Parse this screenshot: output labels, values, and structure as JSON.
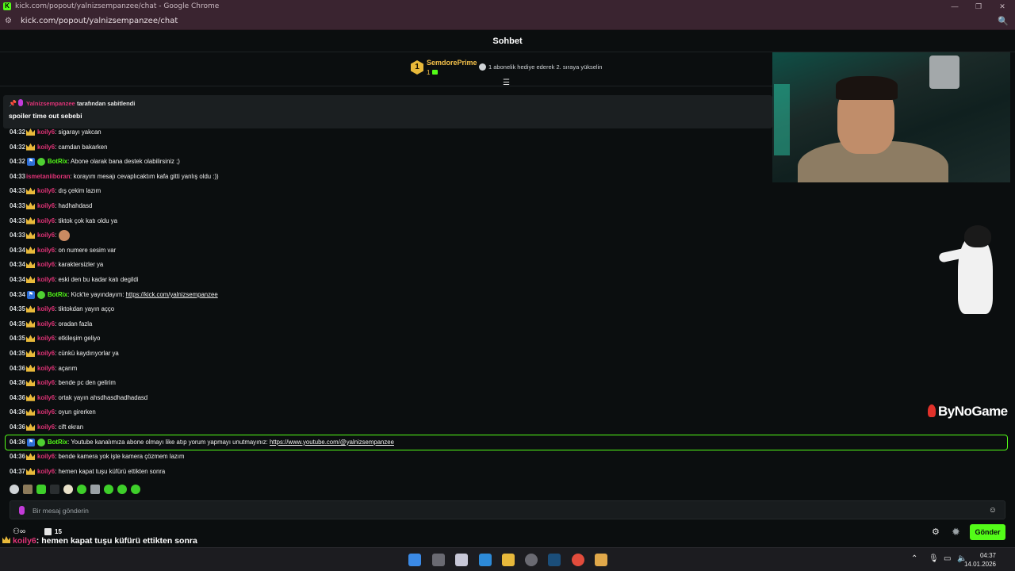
{
  "browser": {
    "window_title": "kick.com/popout/yalnizsempanzee/chat - Google Chrome",
    "favicon_letter": "K",
    "url": "kick.com/popout/yalnizsempanzee/chat"
  },
  "chat_header": {
    "title": "Sohbet"
  },
  "leaderboard": {
    "rank": "1",
    "name": "SemdorePrime",
    "gift_count": "1",
    "hint": "1 abonelik hediye ederek 2. sıraya yükselin"
  },
  "pinned": {
    "pinned_user": "Yalnizsempanzee",
    "pinned_by": "tarafından sabitlendi",
    "message": "spoiler time out sebebi"
  },
  "messages": [
    {
      "time": "04:32",
      "user": "koily6",
      "text": ": sigarayı yakcan"
    },
    {
      "time": "04:32",
      "user": "koily6",
      "text": ": camdan bakarken"
    },
    {
      "time": "04:32",
      "user": "BotRix",
      "text": ": Abone olarak bana destek olabilirsiniz ;)"
    },
    {
      "time": "04:33",
      "user": "ismetaniiboran",
      "text": ": korayım mesajı cevaplıcaktım kafa gitti yanlış oldu :))"
    },
    {
      "time": "04:33",
      "user": "koily6",
      "text": ": dış çekim lazım"
    },
    {
      "time": "04:33",
      "user": "koily6",
      "text": ": hadhahdasd"
    },
    {
      "time": "04:33",
      "user": "koily6",
      "text": ": tiktok çok katı oldu ya"
    },
    {
      "time": "04:33",
      "user": "koily6",
      "text": ":"
    },
    {
      "time": "04:34",
      "user": "koily6",
      "text": ": on numere sesim var"
    },
    {
      "time": "04:34",
      "user": "koily6",
      "text": ": karaktersizler ya"
    },
    {
      "time": "04:34",
      "user": "koily6",
      "text": ": eski den bu kadar katı degildi"
    },
    {
      "time": "04:34",
      "user": "BotRix",
      "text": ": Kick'te yayındayım: ",
      "link": "https://kick.com/yalnizsempanzee"
    },
    {
      "time": "04:35",
      "user": "koily6",
      "text": ": tiktokdan yayın açço"
    },
    {
      "time": "04:35",
      "user": "koily6",
      "text": ": oradan fazla"
    },
    {
      "time": "04:35",
      "user": "koily6",
      "text": ": etkileşim geliyo"
    },
    {
      "time": "04:35",
      "user": "koily6",
      "text": ": cünkü kaydırıyorlar ya"
    },
    {
      "time": "04:36",
      "user": "koily6",
      "text": ": açarım"
    },
    {
      "time": "04:36",
      "user": "koily6",
      "text": ": bende pc den gelirim"
    },
    {
      "time": "04:36",
      "user": "koily6",
      "text": ": ortak yayın ahsdhasdhadhadasd"
    },
    {
      "time": "04:36",
      "user": "koily6",
      "text": ": oyun girerken"
    },
    {
      "time": "04:36",
      "user": "koily6",
      "text": ": cift ekran"
    },
    {
      "time": "04:36",
      "user": "BotRix",
      "text": ": Youtube kanalımıza abone olmayı like atıp yorum yapmayı unutmayınız: ",
      "link": "https://www.youtube.com/@yalnizsempanzee"
    },
    {
      "time": "04:36",
      "user": "koily6",
      "text": ": bende kamera yok işte kamera çözmem lazım"
    },
    {
      "time": "04:37",
      "user": "koily6",
      "text": ": hemen kapat tuşu küfürü ettikten sonra"
    }
  ],
  "overlay": {
    "brand": "ByNoGame"
  },
  "input": {
    "placeholder": "Bir mesaj gönderin",
    "value": ""
  },
  "bottom": {
    "viewers_symbol": "∞",
    "count": "15",
    "send_label": "Gönder",
    "ticker_user": "koily6",
    "ticker_text": ": hemen kapat tuşu küfürü ettikten sonra"
  },
  "taskbar": {
    "time": "04:37",
    "date": "14.01.2026"
  },
  "colors": {
    "accent": "#53fc18",
    "username": "#e03377",
    "bot": "#53fc18",
    "leader": "#f5c14a",
    "background": "#0b0e0f"
  }
}
